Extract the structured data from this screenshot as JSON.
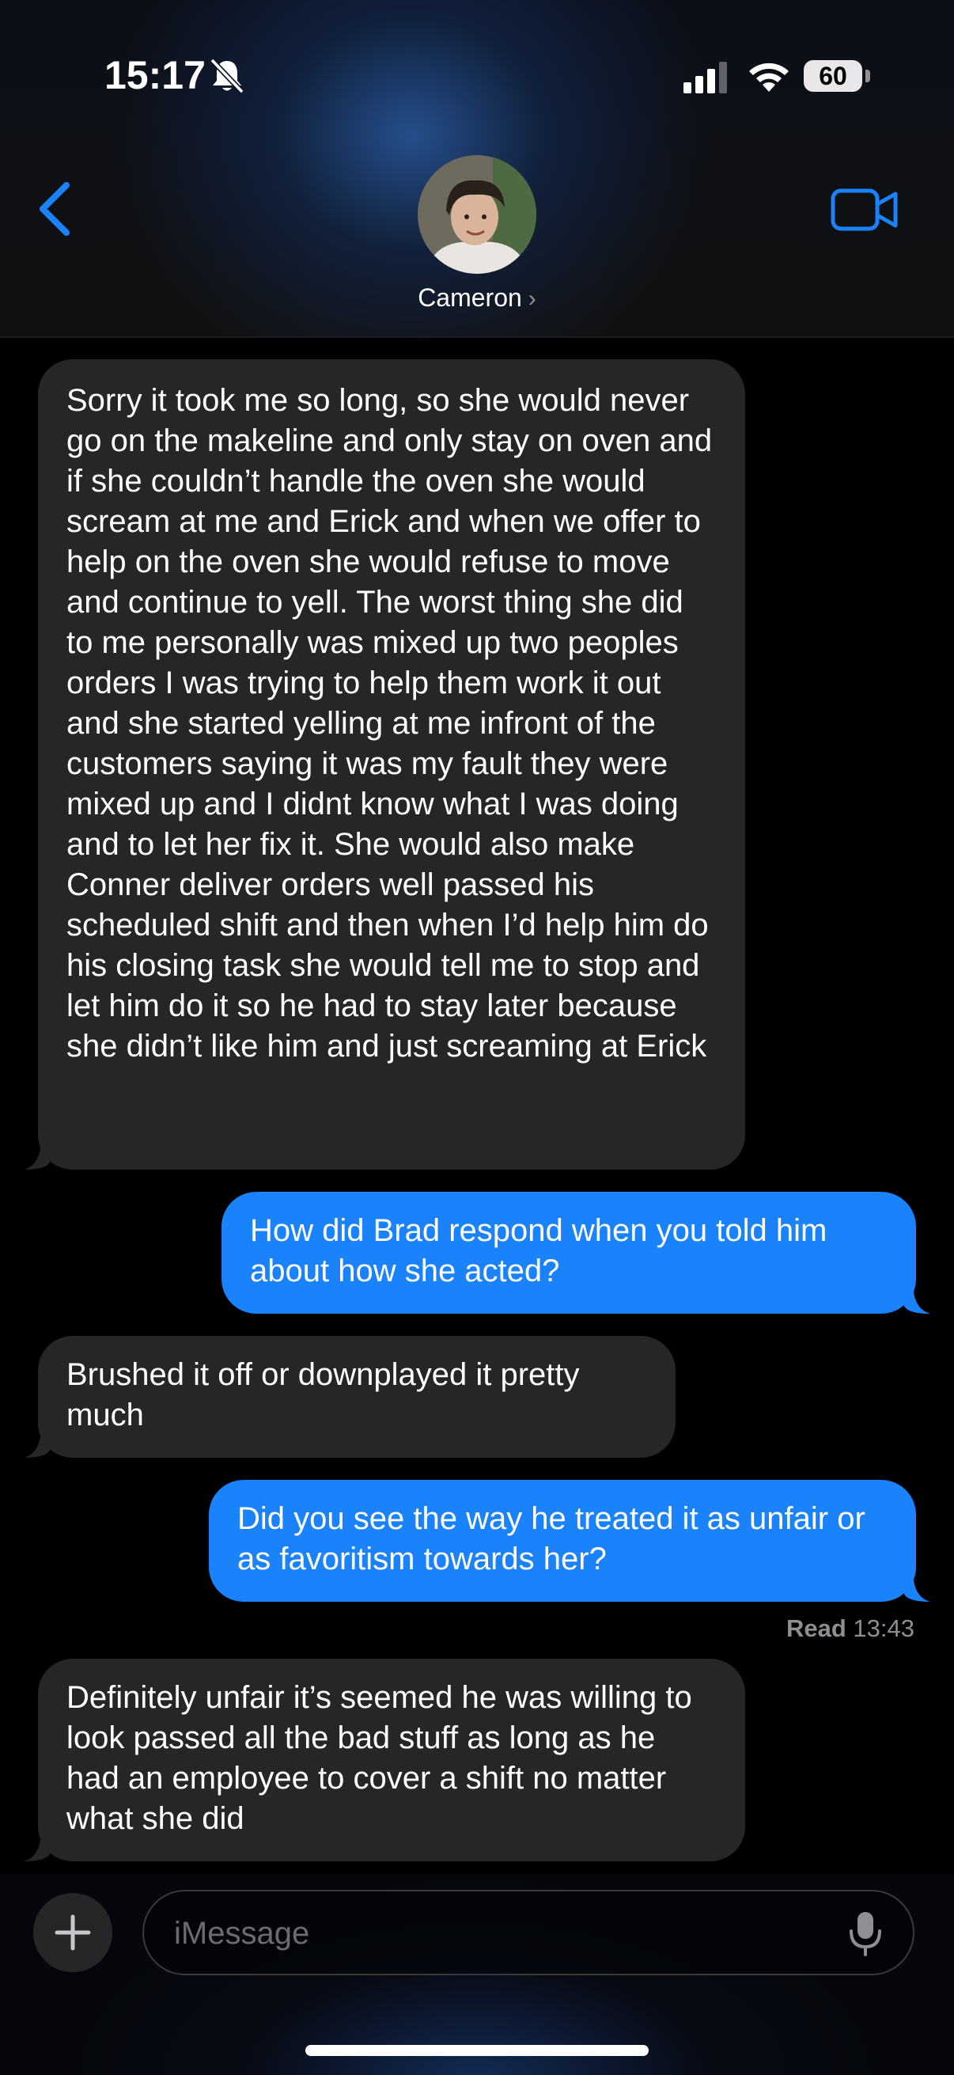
{
  "status_bar": {
    "time": "15:17",
    "battery": "60",
    "icons": [
      "bell-slash-icon",
      "cellular-signal-icon",
      "wifi-icon",
      "battery-icon"
    ]
  },
  "header": {
    "back_icon": "chevron-left-icon",
    "contact_name": "Cameron",
    "contact_chevron": "›",
    "video_icon": "video-camera-icon"
  },
  "messages": [
    {
      "direction": "incoming",
      "text": "Sorry it took me so long, so she would never go on the makeline and only stay on oven and if she couldn’t handle the oven she would scream at me and Erick and when we offer to help on the oven she would refuse to move and continue to yell. The worst thing she did to me personally was mixed up two peoples orders I was trying to help them work it out and she started yelling at me infront of the customers saying it was my fault they were mixed up and I didnt know what I was doing and to let her fix it. She would also make Conner deliver orders well passed his scheduled shift and then when I’d help him do his closing task she would tell me to stop and let him do it so he had to stay later because she didn’t like him and just screaming at Erick"
    },
    {
      "direction": "outgoing",
      "text": "How did Brad respond when you told him about how she acted?"
    },
    {
      "direction": "incoming",
      "text": "Brushed it off or downplayed it pretty much"
    },
    {
      "direction": "outgoing",
      "text": "Did you see the way he treated it as unfair or as favoritism towards her?"
    },
    {
      "direction": "incoming",
      "text": "Definitely unfair it’s seemed he was willing to look passed all the bad stuff as long as he had an employee to cover a shift no matter what she did"
    }
  ],
  "read_receipt": {
    "label": "Read",
    "time": "13:43"
  },
  "composer": {
    "placeholder": "iMessage",
    "value": "",
    "plus_icon": "plus-icon",
    "mic_icon": "microphone-icon"
  },
  "colors": {
    "incoming_bubble": "#262628",
    "outgoing_bubble": "#1a82fb",
    "accent": "#1a82fb",
    "secondary_text": "#8e8e93"
  }
}
